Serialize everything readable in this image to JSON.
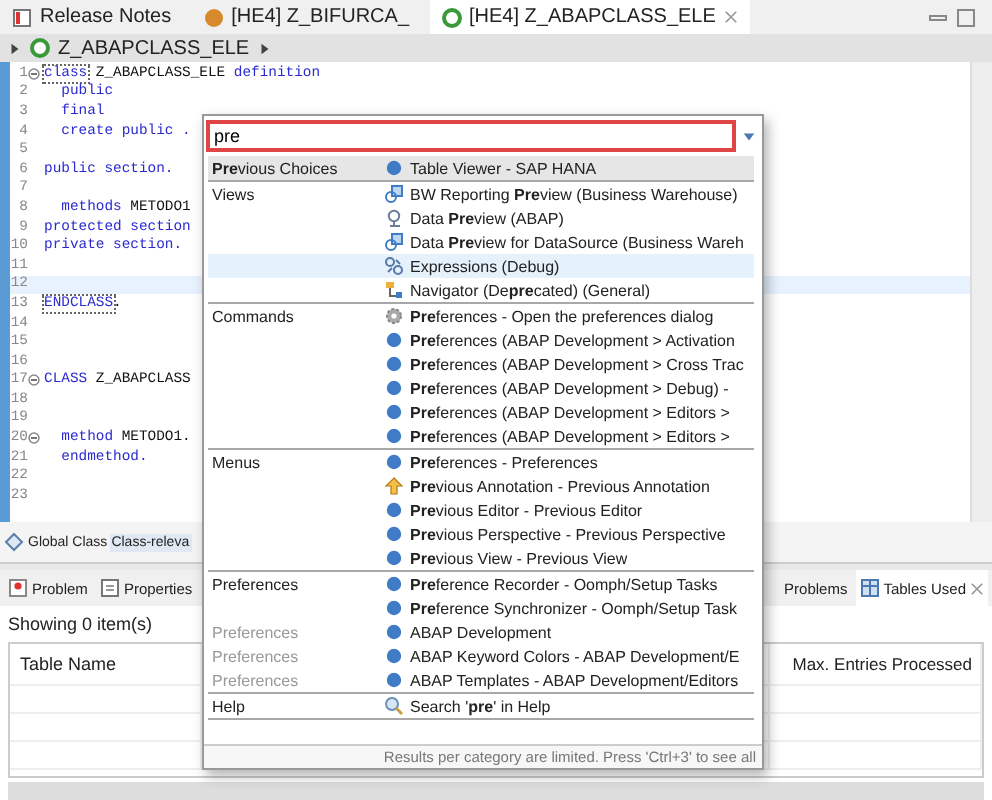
{
  "tabs": [
    {
      "label": "Release Notes",
      "kind": "notes",
      "selected": false
    },
    {
      "label": "[HE4] Z_BIFURCA_",
      "kind": "program",
      "selected": false
    },
    {
      "label": "[HE4] Z_ABAPCLASS_ELE",
      "kind": "class",
      "selected": true
    }
  ],
  "breadcrumb": "Z_ABAPCLASS_ELE",
  "editor": {
    "lines": [
      {
        "number": "1",
        "fold": true,
        "tokens": [
          {
            "text": "class",
            "kind": "matched"
          },
          {
            "text": " Z_ABAPCLASS_ELE ",
            "kind": "plain"
          },
          {
            "text": "definition",
            "kind": "keyword"
          }
        ]
      },
      {
        "number": "2",
        "tokens": [
          {
            "text": "  public",
            "kind": "keyword"
          }
        ]
      },
      {
        "number": "3",
        "tokens": [
          {
            "text": "  final",
            "kind": "keyword"
          }
        ]
      },
      {
        "number": "4",
        "tokens": [
          {
            "text": "  create public .",
            "kind": "keyword"
          }
        ]
      },
      {
        "number": "5"
      },
      {
        "number": "6",
        "tokens": [
          {
            "text": "public section.",
            "kind": "keyword"
          }
        ]
      },
      {
        "number": "7"
      },
      {
        "number": "8",
        "tokens": [
          {
            "text": "  methods",
            "kind": "keyword"
          },
          {
            "text": " METODO1",
            "kind": "plain"
          }
        ]
      },
      {
        "number": "9",
        "tokens": [
          {
            "text": "protected section",
            "kind": "keyword"
          }
        ]
      },
      {
        "number": "10",
        "tokens": [
          {
            "text": "private section.",
            "kind": "keyword"
          }
        ]
      },
      {
        "number": "11"
      },
      {
        "number": "12",
        "current": true
      },
      {
        "number": "13",
        "tokens": [
          {
            "text": "ENDCLASS",
            "kind": "matched"
          },
          {
            "text": ".",
            "kind": "plain"
          }
        ]
      },
      {
        "number": "14"
      },
      {
        "number": "15"
      },
      {
        "number": "16"
      },
      {
        "number": "17",
        "fold": true,
        "tokens": [
          {
            "text": "CLASS",
            "kind": "keyword"
          },
          {
            "text": " Z_ABAPCLASS",
            "kind": "plain"
          }
        ]
      },
      {
        "number": "18"
      },
      {
        "number": "19"
      },
      {
        "number": "20",
        "fold": true,
        "tokens": [
          {
            "text": "  method",
            "kind": "keyword"
          },
          {
            "text": " METODO1.",
            "kind": "plain"
          }
        ]
      },
      {
        "number": "21",
        "tokens": [
          {
            "text": "  endmethod.",
            "kind": "keyword"
          }
        ]
      },
      {
        "number": "22"
      },
      {
        "number": "23"
      }
    ]
  },
  "editor_tabs": [
    {
      "label": "Global Class",
      "selected": false
    },
    {
      "label": "Class-releva",
      "selected": true
    }
  ],
  "panel": {
    "tabs_left": [
      {
        "label": "Problem",
        "kind": "problem"
      },
      {
        "label": "Properties",
        "kind": "properties"
      }
    ],
    "tabs_right": [
      {
        "label": "Problems",
        "selected": false
      },
      {
        "label": "Tables Used",
        "kind": "table",
        "selected": true
      }
    ],
    "status": "Showing 0 item(s)",
    "columns": [
      "Table Name",
      "Max. Entries Processed"
    ]
  },
  "popup": {
    "search": {
      "value": "pre"
    },
    "groups": [
      {
        "category": "**Pre**vious Choices",
        "header": true,
        "items": [
          {
            "text": "Table Viewer - SAP HANA",
            "kind": "dot",
            "selected": false
          }
        ]
      },
      {
        "category": "Views",
        "items": [
          {
            "text": "BW Reporting **Pre**view (Business Warehouse)",
            "kind": "view",
            "selected": false
          },
          {
            "text": "Data **Pre**view (ABAP)",
            "kind": "data",
            "selected": false
          },
          {
            "text": "Data **Pre**view for DataSource (Business Wareh",
            "kind": "view",
            "selected": false
          },
          {
            "text": "Expressions (Debug)",
            "kind": "expressions",
            "selected": true
          },
          {
            "text": "Navigator (De**pre**cated) (General)",
            "kind": "navigator",
            "selected": false
          }
        ]
      },
      {
        "category": "Commands",
        "items": [
          {
            "text": "**Pre**ferences - Open the preferences dialog",
            "kind": "gear",
            "selected": false
          },
          {
            "text": "**Pre**ferences (ABAP Development > Activation",
            "kind": "dot",
            "selected": false
          },
          {
            "text": "**Pre**ferences (ABAP Development > Cross Trac",
            "kind": "dot",
            "selected": false
          },
          {
            "text": "**Pre**ferences (ABAP Development > Debug) -",
            "kind": "dot",
            "selected": false
          },
          {
            "text": "**Pre**ferences (ABAP Development > Editors >",
            "kind": "dot",
            "selected": false
          },
          {
            "text": "**Pre**ferences (ABAP Development > Editors >",
            "kind": "dot",
            "selected": false
          }
        ]
      },
      {
        "category": "Menus",
        "items": [
          {
            "text": "**Pre**ferences - Preferences",
            "kind": "dot",
            "selected": false
          },
          {
            "text": "**Pre**vious Annotation - Previous Annotation",
            "kind": "annotation",
            "selected": false
          },
          {
            "text": "**Pre**vious Editor - Previous Editor",
            "kind": "dot",
            "selected": false
          },
          {
            "text": "**Pre**vious Perspective - Previous Perspective",
            "kind": "dot",
            "selected": false
          },
          {
            "text": "**Pre**vious View - Previous View",
            "kind": "dot",
            "selected": false
          }
        ]
      },
      {
        "category": "Preferences",
        "items": [
          {
            "text": "**Pre**ference Recorder - Oomph/Setup Tasks",
            "kind": "dot",
            "selected": false
          },
          {
            "text": "**Pre**ference Synchronizer - Oomph/Setup Task",
            "kind": "dot",
            "selected": false
          },
          {
            "category": "Preferences",
            "text": "ABAP Development",
            "kind": "dot",
            "selected": false
          },
          {
            "category": "Preferences",
            "text": "ABAP Keyword Colors - ABAP Development/E",
            "kind": "dot",
            "selected": false
          },
          {
            "category": "Preferences",
            "text": "ABAP Templates - ABAP Development/Editors",
            "kind": "dot",
            "selected": false
          }
        ]
      },
      {
        "category": "Help",
        "items": [
          {
            "text": "Search '**pre**' in Help",
            "kind": "help",
            "selected": false
          }
        ]
      }
    ],
    "footer": "Results per category are limited. Press 'Ctrl+3' to see all"
  }
}
